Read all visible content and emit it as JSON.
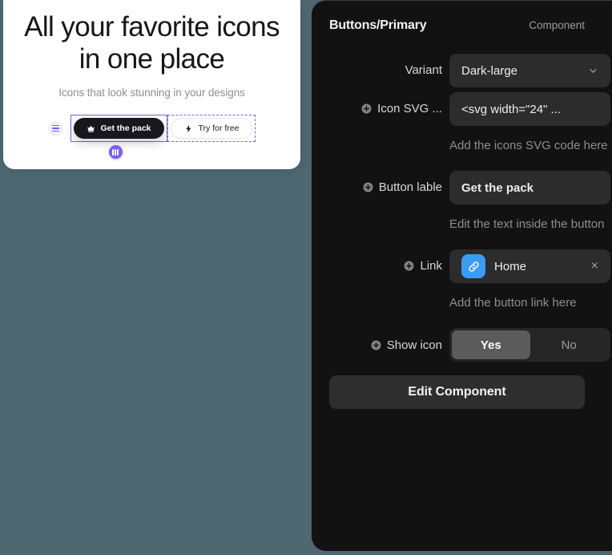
{
  "theme": {
    "background": "#4e6771",
    "panel_bg": "#121212",
    "field_bg": "#2c2c2c",
    "accent_purple": "#7c5cfc",
    "link_blue": "#3b9bf5",
    "dark_button": "#16181c"
  },
  "preview": {
    "title": "All your favorite icons in one place",
    "subtitle": "Icons that look stunning in your designs",
    "drag_handle_icon": "drag-lines-icon",
    "resize_handle_icon": "resize-bars-icon",
    "primary_button": {
      "label": "Get the pack",
      "icon": "crown-icon"
    },
    "secondary_button": {
      "label": "Try for free",
      "icon": "lightning-bolt-icon"
    }
  },
  "panel": {
    "title": "Buttons/Primary",
    "kind": "Component",
    "rows": [
      {
        "label": "Variant",
        "value": "Dark-large",
        "chevron_icon": "chevron-down-icon",
        "helper": ""
      },
      {
        "label": "Icon SVG ...",
        "plus_icon": "circle-plus-icon",
        "value": "<svg width=\"24\" ...",
        "helper": "Add the icons SVG code here"
      },
      {
        "label": "Button lable",
        "plus_icon": "circle-plus-icon",
        "value": "Get the pack",
        "helper": "Edit the text inside the button"
      },
      {
        "label": "Link",
        "plus_icon": "circle-plus-icon",
        "value": "Home",
        "chip_icon": "link-chain-icon",
        "clear_label": "×",
        "helper": "Add the button link here"
      },
      {
        "label": "Show icon",
        "plus_icon": "circle-plus-icon",
        "options": [
          "Yes",
          "No"
        ],
        "selected": "Yes",
        "helper": ""
      }
    ],
    "edit_component_label": "Edit Component"
  }
}
